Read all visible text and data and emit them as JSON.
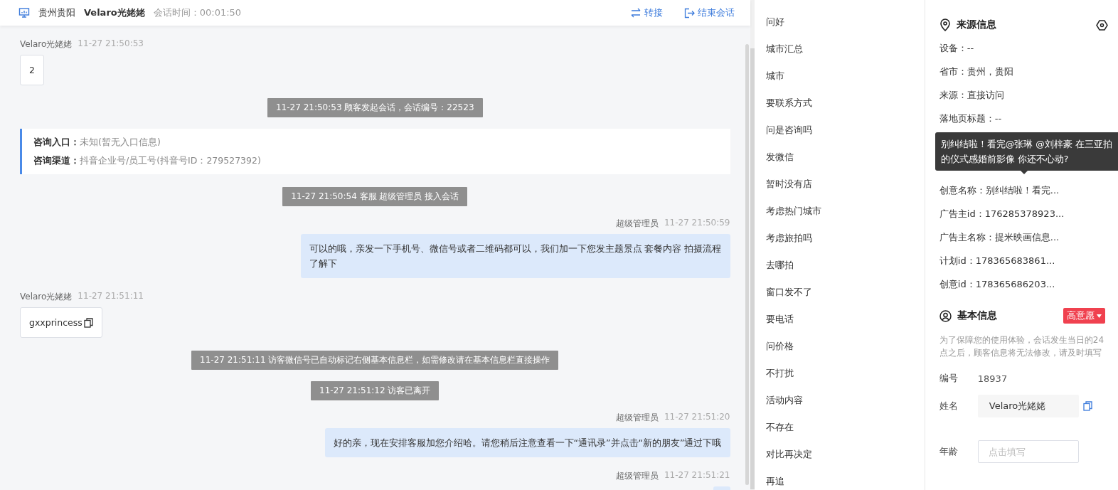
{
  "header": {
    "location": "贵州贵阳",
    "visitor": "Velaro光姥姥",
    "session_time": "会话时间：00:01:50",
    "actions": [
      {
        "kind": "transfer",
        "label": "转接"
      },
      {
        "kind": "end",
        "label": "结束会话"
      }
    ]
  },
  "messages": [
    {
      "kind": "left",
      "sender": "Velaro光姥姥",
      "time": "11-27 21:50:53",
      "text": "2",
      "copyable": false
    },
    {
      "kind": "system",
      "text": "11-27 21:50:53 顾客发起会话，会话编号：22523"
    },
    {
      "kind": "info",
      "lines": [
        {
          "label": "咨询入口：",
          "value": "未知(暂无入口信息)"
        },
        {
          "label": "咨询渠道：",
          "value": "抖音企业号/员工号(抖音号ID：279527392)"
        }
      ]
    },
    {
      "kind": "system",
      "text": "11-27 21:50:54 客服 超级管理员 接入会话"
    },
    {
      "kind": "right",
      "sender": "超级管理员",
      "time": "11-27 21:50:59",
      "text": "可以的哦，亲发一下手机号、微信号或者二维码都可以，我们加一下您发主题景点 套餐内容 拍摄流程了解下"
    },
    {
      "kind": "left",
      "sender": "Velaro光姥姥",
      "time": "11-27 21:51:11",
      "text": "gxxprincess",
      "copyable": true
    },
    {
      "kind": "system",
      "text": "11-27 21:51:11 访客微信号已自动标记右侧基本信息栏，如需修改请在基本信息栏直接操作"
    },
    {
      "kind": "system",
      "text": "11-27 21:51:12 访客已离开"
    },
    {
      "kind": "right",
      "sender": "超级管理员",
      "time": "11-27 21:51:20",
      "text": "好的亲，现在安排客服加您介绍哈。请您稍后注意查看一下“通讯录”并点击“新的朋友”通过下哦"
    },
    {
      "kind": "right",
      "sender": "超级管理员",
      "time": "11-27 21:51:21"
    }
  ],
  "quick_replies": [
    "问好",
    "城市汇总",
    "城市",
    "要联系方式",
    "问是咨询吗",
    "发微信",
    "暂时没有店",
    "考虑热门城市",
    "考虑旅拍吗",
    "去哪拍",
    "窗口发不了",
    "要电话",
    "问价格",
    "不打扰",
    "活动内容",
    "不存在",
    "对比再决定",
    "再追"
  ],
  "source_info": {
    "title": "来源信息",
    "rows_before": [
      "设备：--",
      "省市：贵州，贵阳",
      "来源：直接访问",
      "落地页标题：--"
    ],
    "tooltip": "别纠结啦！看完@张琳 @刘梓豪 在三亚拍的仪式感婚前影像 你还不心动?",
    "rows_after": [
      "创意名称：别纠结啦！看完...",
      "广告主id：176285378923...",
      "广告主名称：提米映画信息...",
      "计划id：178365683861...",
      "创意id：178365686203..."
    ]
  },
  "basic_info": {
    "title": "基本信息",
    "intent": "高意愿",
    "hint": "为了保障您的使用体验，会话发生当日的24点之后，顾客信息将无法修改，请及时填写",
    "fields": [
      {
        "kind": "text",
        "label": "编号",
        "value": "18937"
      },
      {
        "kind": "filled",
        "label": "姓名",
        "value": "Velaro光姥姥"
      },
      {
        "kind": "input",
        "label": "年龄",
        "placeholder": "点击填写"
      }
    ]
  }
}
